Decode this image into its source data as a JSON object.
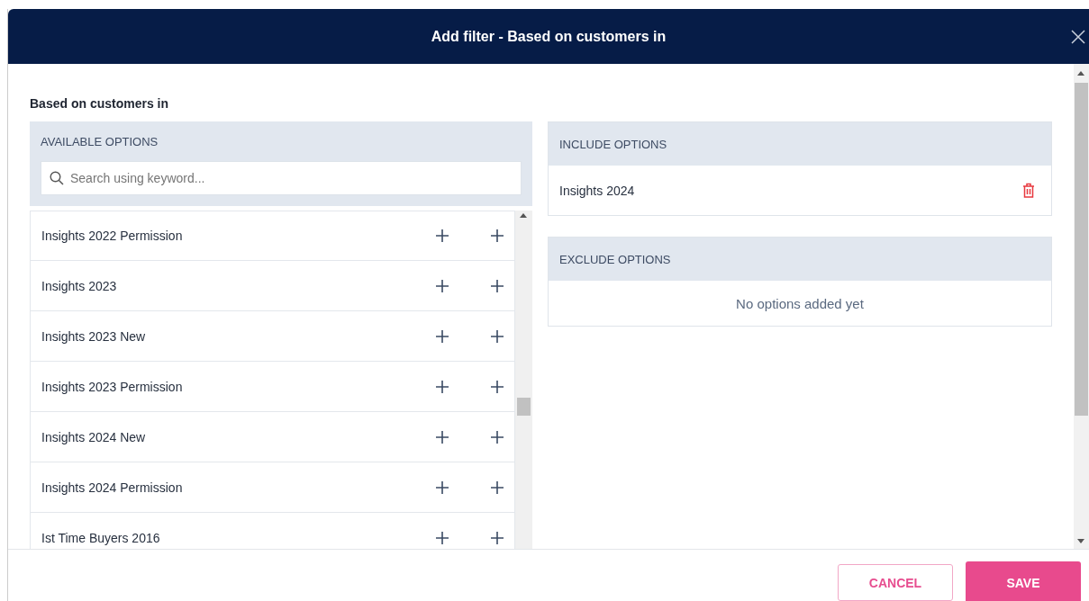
{
  "dialog": {
    "title": "Add filter - Based on customers in"
  },
  "section_title": "Based on customers in",
  "available": {
    "heading": "AVAILABLE OPTIONS",
    "search": {
      "placeholder": "Search using keyword..."
    },
    "items": [
      {
        "label": "Insights 2022 Permission"
      },
      {
        "label": "Insights 2023"
      },
      {
        "label": "Insights 2023 New"
      },
      {
        "label": "Insights 2023 Permission"
      },
      {
        "label": "Insights 2024 New"
      },
      {
        "label": "Insights 2024 Permission"
      },
      {
        "label": "Ist Time Buyers 2016"
      }
    ]
  },
  "include": {
    "heading": "INCLUDE OPTIONS",
    "items": [
      {
        "label": "Insights 2024"
      }
    ]
  },
  "exclude": {
    "heading": "EXCLUDE OPTIONS",
    "empty_text": "No options added yet"
  },
  "buttons": [
    {
      "label": "CANCEL",
      "kind": "secondary"
    },
    {
      "label": "SAVE",
      "kind": "primary"
    }
  ]
}
